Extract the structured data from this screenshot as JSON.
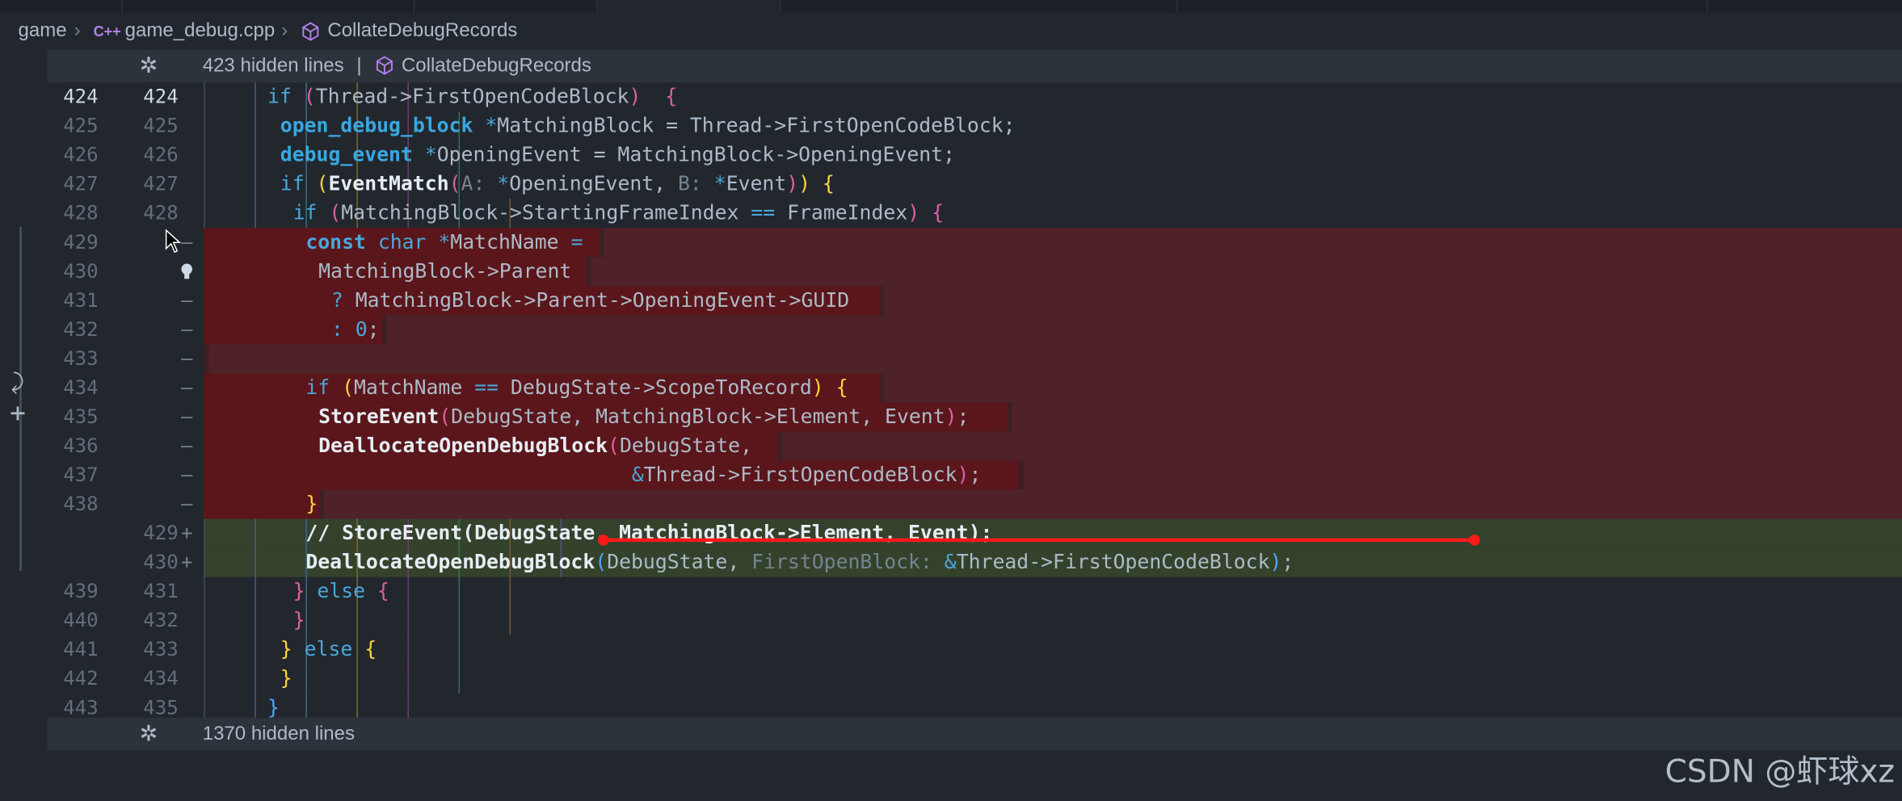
{
  "breadcrumb": {
    "folder": "game",
    "file_icon_text": "C++",
    "file": "game_debug.cpp",
    "symbol": "CollateDebugRecords"
  },
  "fold_top": {
    "label": "423 hidden lines",
    "divider": "|",
    "symbol": "CollateDebugRecords"
  },
  "fold_bottom": {
    "label": "1370 hidden lines"
  },
  "watermark": "CSDN @虾球xz",
  "colors": {
    "deleted_bg": "#5a161b",
    "added_bg": "#34422c",
    "annotation": "#ff1a1a"
  },
  "lines": [
    {
      "old": "424",
      "new": "424",
      "mark": "",
      "kind": "ctx",
      "indent": 5,
      "tokens": [
        [
          "kw",
          "if "
        ],
        [
          "br2",
          "("
        ],
        [
          "",
          "Thread->FirstOpenCodeBlock"
        ],
        [
          "br2",
          ")"
        ],
        [
          "",
          "  "
        ],
        [
          "br2",
          "{"
        ]
      ]
    },
    {
      "old": "425",
      "new": "425",
      "mark": "",
      "kind": "ctx",
      "indent": 6,
      "tokens": [
        [
          "ty",
          "open_debug_block "
        ],
        [
          "op",
          "*"
        ],
        [
          "",
          "MatchingBlock = Thread->FirstOpenCodeBlock;"
        ]
      ]
    },
    {
      "old": "426",
      "new": "426",
      "mark": "",
      "kind": "ctx",
      "indent": 6,
      "tokens": [
        [
          "ty",
          "debug_event "
        ],
        [
          "op",
          "*"
        ],
        [
          "",
          "OpeningEvent = MatchingBlock->OpeningEvent;"
        ]
      ]
    },
    {
      "old": "427",
      "new": "427",
      "mark": "",
      "kind": "ctx",
      "indent": 6,
      "tokens": [
        [
          "kw",
          "if "
        ],
        [
          "br1",
          "("
        ],
        [
          "fn",
          "EventMatch"
        ],
        [
          "br2",
          "("
        ],
        [
          "hint",
          "A: "
        ],
        [
          "op",
          "*"
        ],
        [
          "",
          "OpeningEvent, "
        ],
        [
          "hint",
          "B: "
        ],
        [
          "op",
          "*"
        ],
        [
          "",
          "Event"
        ],
        [
          "br2",
          ")"
        ],
        [
          "br1",
          ")"
        ],
        [
          "",
          " "
        ],
        [
          "br1",
          "{"
        ]
      ]
    },
    {
      "old": "428",
      "new": "428",
      "mark": "",
      "kind": "ctx",
      "indent": 7,
      "tokens": [
        [
          "kw",
          "if "
        ],
        [
          "br2",
          "("
        ],
        [
          "",
          "MatchingBlock->StartingFrameIndex "
        ],
        [
          "op",
          "=="
        ],
        [
          "",
          " FrameIndex"
        ],
        [
          "br2",
          ")"
        ],
        [
          "",
          " "
        ],
        [
          "br2",
          "{"
        ]
      ]
    },
    {
      "old": "429",
      "new": "",
      "mark": "—",
      "kind": "del",
      "indent": 8,
      "tokens": [
        [
          "kwb",
          "const "
        ],
        [
          "kw",
          "char "
        ],
        [
          "op",
          "*"
        ],
        [
          "",
          "MatchName "
        ],
        [
          "op",
          "="
        ]
      ]
    },
    {
      "old": "430",
      "new": "",
      "mark": "bulb",
      "kind": "del",
      "indent": 9,
      "tokens": [
        [
          "",
          "MatchingBlock->Parent"
        ]
      ]
    },
    {
      "old": "431",
      "new": "",
      "mark": "—",
      "kind": "del",
      "indent": 10,
      "tokens": [
        [
          "op",
          "? "
        ],
        [
          "",
          "MatchingBlock->Parent->OpeningEvent->GUID"
        ]
      ]
    },
    {
      "old": "432",
      "new": "",
      "mark": "—",
      "kind": "del",
      "indent": 10,
      "tokens": [
        [
          "op",
          ": "
        ],
        [
          "num",
          "0"
        ],
        [
          "",
          ";"
        ]
      ]
    },
    {
      "old": "433",
      "new": "",
      "mark": "—",
      "kind": "del",
      "indent": 0,
      "tokens": []
    },
    {
      "old": "434",
      "new": "",
      "mark": "—",
      "kind": "del",
      "indent": 8,
      "tokens": [
        [
          "kw",
          "if "
        ],
        [
          "br1",
          "("
        ],
        [
          "",
          "MatchName "
        ],
        [
          "op",
          "=="
        ],
        [
          "",
          " DebugState->ScopeToRecord"
        ],
        [
          "br1",
          ")"
        ],
        [
          "",
          " "
        ],
        [
          "br1",
          "{"
        ]
      ]
    },
    {
      "old": "435",
      "new": "",
      "mark": "—",
      "kind": "del",
      "indent": 9,
      "tokens": [
        [
          "fn",
          "StoreEvent"
        ],
        [
          "br2",
          "("
        ],
        [
          "",
          "DebugState, MatchingBlock->Element, Event"
        ],
        [
          "br2",
          ")"
        ],
        [
          "",
          ";"
        ]
      ]
    },
    {
      "old": "436",
      "new": "",
      "mark": "—",
      "kind": "del",
      "indent": 9,
      "tokens": [
        [
          "fn",
          "DeallocateOpenDebugBlock"
        ],
        [
          "br2",
          "("
        ],
        [
          "",
          "DebugState,"
        ]
      ]
    },
    {
      "old": "437",
      "new": "",
      "mark": "—",
      "kind": "del",
      "indent": 9,
      "pad": "                          ",
      "tokens": [
        [
          "op",
          "&"
        ],
        [
          "",
          "Thread->FirstOpenCodeBlock"
        ],
        [
          "br2",
          ")"
        ],
        [
          "",
          ";"
        ]
      ]
    },
    {
      "old": "438",
      "new": "",
      "mark": "—",
      "kind": "del",
      "indent": 8,
      "tokens": [
        [
          "br1",
          "}"
        ]
      ]
    },
    {
      "old": "",
      "new": "429",
      "mark": "+",
      "kind": "add",
      "indent": 8,
      "tokens": [
        [
          "cmt",
          "// StoreEvent(DebugState, MatchingBlock->Element, Event);"
        ]
      ]
    },
    {
      "old": "",
      "new": "430",
      "mark": "+",
      "kind": "add",
      "indent": 8,
      "tokens": [
        [
          "fn",
          "DeallocateOpenDebugBlock"
        ],
        [
          "br3",
          "("
        ],
        [
          "",
          "DebugState, "
        ],
        [
          "hint",
          "FirstOpenBlock: "
        ],
        [
          "op",
          "&"
        ],
        [
          "",
          "Thread->FirstOpenCodeBlock"
        ],
        [
          "br3",
          ")"
        ],
        [
          "",
          ";"
        ]
      ]
    },
    {
      "old": "439",
      "new": "431",
      "mark": "",
      "kind": "ctx",
      "indent": 7,
      "tokens": [
        [
          "br2",
          "}"
        ],
        [
          "",
          " "
        ],
        [
          "kw",
          "else "
        ],
        [
          "br2",
          "{"
        ]
      ]
    },
    {
      "old": "440",
      "new": "432",
      "mark": "",
      "kind": "ctx",
      "indent": 7,
      "tokens": [
        [
          "br2",
          "}"
        ]
      ]
    },
    {
      "old": "441",
      "new": "433",
      "mark": "",
      "kind": "ctx",
      "indent": 6,
      "tokens": [
        [
          "br1",
          "}"
        ],
        [
          "",
          " "
        ],
        [
          "kw",
          "else "
        ],
        [
          "br1",
          "{"
        ]
      ]
    },
    {
      "old": "442",
      "new": "434",
      "mark": "",
      "kind": "ctx",
      "indent": 6,
      "tokens": [
        [
          "br1",
          "}"
        ]
      ]
    },
    {
      "old": "443",
      "new": "435",
      "mark": "",
      "kind": "ctx",
      "indent": 5,
      "tokens": [
        [
          "br3",
          "}"
        ]
      ]
    }
  ]
}
